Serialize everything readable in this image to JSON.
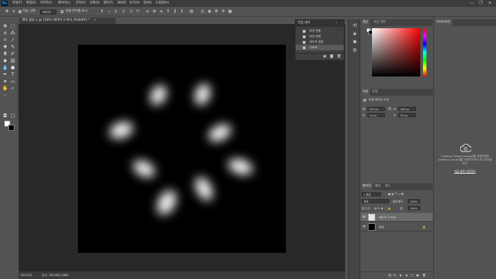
{
  "app": {
    "logo": "Ps"
  },
  "menu": [
    "파일(F)",
    "편집(E)",
    "이미지(I)",
    "레이어(L)",
    "문자(Y)",
    "선택(S)",
    "필터(T)",
    "3D(D)",
    "보기(V)",
    "창(W)",
    "도움말(H)"
  ],
  "window_controls": {
    "minimize": "—",
    "restore": "❐",
    "close": "✕"
  },
  "options_bar": {
    "auto_select_label": "자동 선택:",
    "auto_select_value": "레이어",
    "transform_controls_label": "변형 컨트롤 표시"
  },
  "document": {
    "tab_title": "제목 없음-1 @ 150% (레이어 2 복사, RGB/8#) *",
    "tab_close": "×"
  },
  "status": {
    "zoom": "150.01%",
    "doc_info": "문서: 760.0K/1.66M"
  },
  "history_panel": {
    "title": "작업 내역",
    "items": [
      "자유 변형",
      "자유 변형",
      "레이어 병합",
      "극좌표"
    ]
  },
  "color_panel": {
    "tabs": [
      "색상",
      "색상 견본"
    ],
    "hue_color": "#ff0000"
  },
  "properties_panel": {
    "tabs": [
      "속성",
      "조정"
    ],
    "heading": "픽셀 레이어 속성",
    "w_label": "W:",
    "w_value": "479 px",
    "h_label": "H:",
    "h_value": "489 px",
    "link_icon": "⛓",
    "x_label": "X:",
    "x_value": "13 px",
    "y_label": "Y:",
    "y_value": "35 px"
  },
  "layers_panel": {
    "tabs": [
      "레이어",
      "채널",
      "패스"
    ],
    "kind_label": "종류",
    "blend_mode": "표준",
    "opacity_label": "불투명도:",
    "opacity_value": "100%",
    "lock_label": "잠그기:",
    "fill_label": "칠:",
    "fill_value": "100%",
    "layers": [
      {
        "name": "레이어 2 복사",
        "selected": true
      },
      {
        "name": "배경",
        "selected": false
      }
    ],
    "bottom_icons": [
      "⛓",
      "fx",
      "◐",
      "◑",
      "▢",
      "▣",
      "🗑"
    ]
  },
  "cc_panel": {
    "title": "라이브러리",
    "message": "Creative Cloud Libraries를 사용하려면 Creative Cloud 앱을 다운로드하고 로그인하십시오.",
    "link": "지금 바로 다운로드"
  }
}
